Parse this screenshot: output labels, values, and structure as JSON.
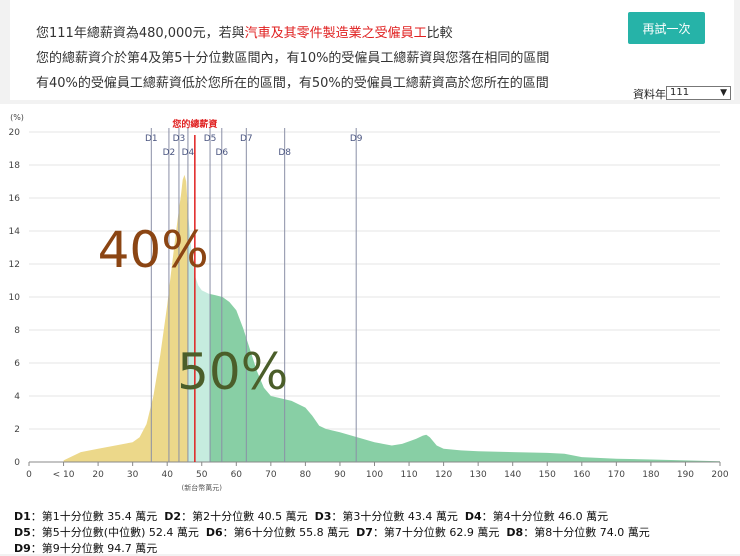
{
  "header": {
    "line1_prefix": "您111年總薪資為480,000元，若與",
    "line1_industry": "汽車及其零件製造業之受僱員工",
    "line1_suffix": "比較",
    "line2": "您的總薪資介於第4及第5十分位數區間內，有10%的受僱員工總薪資與您落在相同的區間",
    "line3": "有40%的受僱員工總薪資低於您所在的區間，有50%的受僱員工總薪資高於您所在的區間",
    "retry_label": "再試一次",
    "year_label": "資料年",
    "year_value": "111"
  },
  "chart_data": {
    "type": "area",
    "ylabel": "(%)",
    "xlabel": "(新台幣萬元)",
    "ylim": [
      0,
      20
    ],
    "xlim": [
      0,
      200
    ],
    "y_ticks": [
      0,
      2,
      4,
      6,
      8,
      10,
      12,
      14,
      16,
      18,
      20
    ],
    "x_ticks": [
      "0",
      "< 10",
      "20",
      "30",
      "40",
      "50",
      "60",
      "70",
      "80",
      "90",
      "100",
      "110",
      "120",
      "130",
      "140",
      "150",
      "160",
      "170",
      "180",
      "190",
      "200"
    ],
    "x": [
      10,
      15,
      20,
      25,
      30,
      32,
      34,
      36,
      38,
      40,
      41,
      42,
      43,
      44,
      44.5,
      45,
      45.5,
      46,
      47,
      48,
      49,
      50,
      51,
      52,
      54,
      56,
      58,
      60,
      62,
      64,
      66,
      68,
      70,
      72,
      74,
      76,
      78,
      80,
      82,
      84,
      86,
      90,
      95,
      100,
      105,
      108,
      110,
      112,
      114,
      115,
      116,
      118,
      120,
      125,
      130,
      140,
      150,
      155,
      160,
      170,
      180,
      190,
      200
    ],
    "y": [
      0.1,
      0.6,
      0.8,
      1.0,
      1.2,
      1.5,
      2.3,
      4.0,
      6.5,
      9.5,
      11.3,
      13.0,
      14.7,
      16.2,
      17.1,
      17.4,
      17.0,
      15.2,
      12.8,
      11.3,
      10.7,
      10.4,
      10.3,
      10.2,
      10.1,
      10.0,
      9.7,
      9.2,
      8.1,
      6.8,
      5.5,
      4.5,
      4.0,
      3.9,
      3.8,
      3.7,
      3.5,
      3.3,
      2.8,
      2.2,
      2.0,
      1.8,
      1.5,
      1.2,
      1.0,
      1.1,
      1.25,
      1.4,
      1.6,
      1.65,
      1.5,
      1.0,
      0.8,
      0.7,
      0.65,
      0.6,
      0.55,
      0.5,
      0.3,
      0.2,
      0.15,
      0.1,
      0.05
    ],
    "deciles": [
      {
        "label": "D1",
        "value": 35.4,
        "row": 0
      },
      {
        "label": "D2",
        "value": 40.5,
        "row": 1
      },
      {
        "label": "D3",
        "value": 43.4,
        "row": 0
      },
      {
        "label": "D4",
        "value": 46.0,
        "row": 1
      },
      {
        "label": "D5",
        "value": 52.4,
        "row": 0
      },
      {
        "label": "D6",
        "value": 55.8,
        "row": 1
      },
      {
        "label": "D7",
        "value": 62.9,
        "row": 0
      },
      {
        "label": "D8",
        "value": 74.0,
        "row": 1
      },
      {
        "label": "D9",
        "value": 94.7,
        "row": 0
      }
    ],
    "your_salary": {
      "label": "您的總薪資",
      "value": 48.0
    },
    "annotations": [
      {
        "text": "40%",
        "x": 29,
        "y": 12,
        "color": "#8b4513"
      },
      {
        "text": "50%",
        "x": 52,
        "y": 4.6,
        "color": "#4b5e2a"
      }
    ],
    "colors": {
      "lower": "#ecd88a",
      "same": "#c6ecdf",
      "higher": "#88cfa5",
      "decile_line": "#8a8fa6",
      "salary_line": "#e02020"
    }
  },
  "legend": {
    "rows": [
      [
        {
          "key": "D1",
          "text": "：第1十分位數 35.4 萬元"
        },
        {
          "key": "D2",
          "text": "：第2十分位數 40.5 萬元"
        },
        {
          "key": "D3",
          "text": "：第3十分位數 43.4 萬元"
        },
        {
          "key": "D4",
          "text": "：第4十分位數 46.0 萬元"
        }
      ],
      [
        {
          "key": "D5",
          "text": "：第5十分位數(中位數) 52.4 萬元"
        },
        {
          "key": "D6",
          "text": "：第6十分位數 55.8 萬元"
        },
        {
          "key": "D7",
          "text": "：第7十分位數 62.9 萬元"
        },
        {
          "key": "D8",
          "text": "：第8十分位數 74.0 萬元"
        }
      ],
      [
        {
          "key": "D9",
          "text": "：第9十分位數 94.7 萬元"
        }
      ]
    ]
  }
}
